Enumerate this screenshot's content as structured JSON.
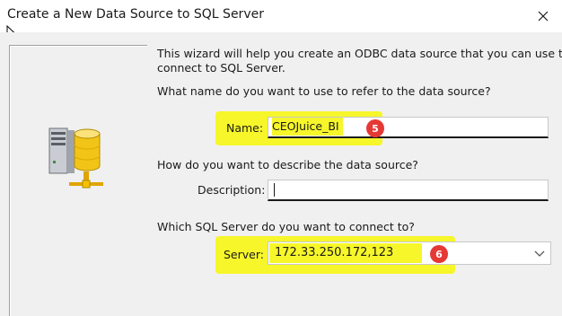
{
  "window": {
    "title": "Create a New Data Source to SQL Server",
    "close_glyph": "✕"
  },
  "intro": {
    "line1": "This wizard will help you create an ODBC data source that you can use to",
    "line2": "connect to SQL Server."
  },
  "name_section": {
    "question": "What name do you want to use to refer to the data source?",
    "label": "Name:",
    "value": "CEOJuice_BI",
    "step_badge": "5"
  },
  "description_section": {
    "question": "How do you want to describe the data source?",
    "label": "Description:",
    "value": ""
  },
  "server_section": {
    "question": "Which SQL Server do you want to connect to?",
    "label": "Server:",
    "value": "172.33.250.172,123",
    "step_badge": "6"
  },
  "colors": {
    "highlight": "#f6f62a",
    "badge": "#e53935",
    "dialog_bg": "#f0f0f0"
  },
  "icons": {
    "close": "close-icon",
    "cursor": "mouse-cursor-icon",
    "server": "database-server-icon",
    "dropdown": "chevron-down-icon"
  }
}
